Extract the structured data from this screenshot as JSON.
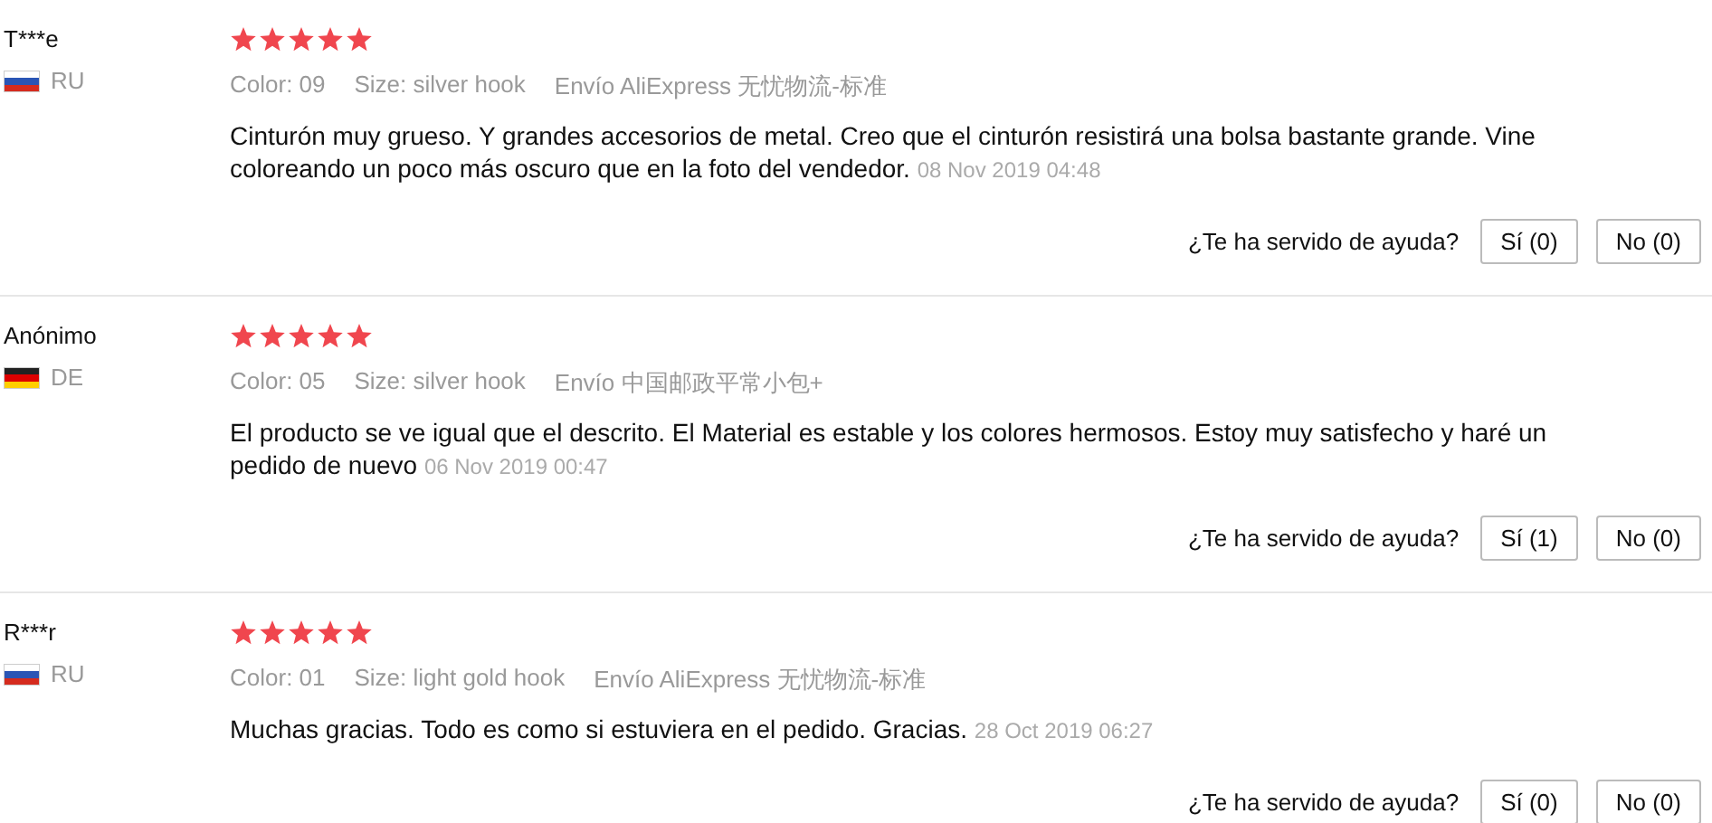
{
  "reviews": [
    {
      "name": "T***e",
      "kind": "ru",
      "country": "RU",
      "stars": 5,
      "color_option": "Color: 09",
      "size": "Size: silver hook",
      "shipping": "Envío AliExpress 无忧物流-标准",
      "text": "Cinturón muy grueso. Y grandes accesorios de metal. Creo que el cinturón resistirá una bolsa bastante grande. Vine coloreando un poco más oscuro que en la foto del vendedor.",
      "date": "08 Nov 2019 04:48",
      "help_question": "¿Te ha servido de ayuda?",
      "yes": "Sí (0)",
      "no": "No (0)"
    },
    {
      "name": "Anónimo",
      "kind": "de",
      "country": "DE",
      "stars": 5,
      "color_option": "Color: 05",
      "size": "Size: silver hook",
      "shipping": "Envío 中国邮政平常小包+",
      "text": "El producto se ve igual que el descrito. El Material es estable y los colores hermosos. Estoy muy satisfecho y haré un pedido de nuevo",
      "date": "06 Nov 2019 00:47",
      "help_question": "¿Te ha servido de ayuda?",
      "yes": "Sí (1)",
      "no": "No (0)"
    },
    {
      "name": "R***r",
      "kind": "ru",
      "country": "RU",
      "stars": 5,
      "color_option": "Color: 01",
      "size": "Size: light gold hook",
      "shipping": "Envío AliExpress 无忧物流-标准",
      "text": "Muchas gracias. Todo es como si estuviera en el pedido. Gracias.",
      "date": "28 Oct 2019 06:27",
      "help_question": "¿Te ha servido de ayuda?",
      "yes": "Sí (0)",
      "no": "No (0)"
    }
  ]
}
